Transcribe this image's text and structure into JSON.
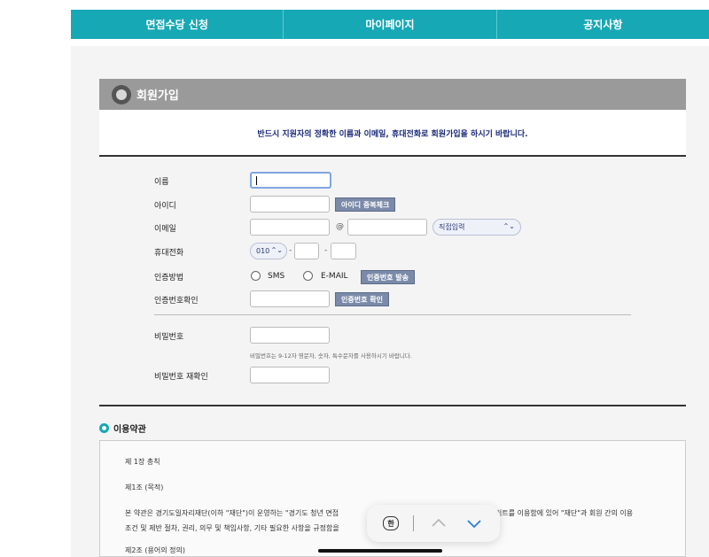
{
  "nav": {
    "items": [
      "면접수당 신청",
      "마이페이지",
      "공지사항"
    ]
  },
  "banner": {
    "title": "회원가입"
  },
  "notice": "반드시 지원자의 정확한 이름과 이메일, 휴대전화로 회원가입을 하시기 바랍니다.",
  "form": {
    "name_label": "이름",
    "id_label": "아이디",
    "id_check_button": "아이디 중복체크",
    "email_label": "이메일",
    "email_at": "@",
    "email_domain_select": "직접입력",
    "phone_label": "휴대전화",
    "phone_prefix": "010",
    "phone_dash": "-",
    "auth_method_label": "인증방법",
    "auth_sms": "SMS",
    "auth_email": "E-MAIL",
    "auth_send_button": "인증번호 발송",
    "auth_confirm_label": "인증번호확인",
    "auth_confirm_button": "인증번호 확인",
    "password_label": "비밀번호",
    "password_hint": "비밀번호는 9-12자 영문자, 숫자, 특수문자를 사용하시기 바랍니다.",
    "password_confirm_label": "비밀번호 재확인"
  },
  "terms": {
    "title": "이용약관",
    "chapter": "제 1장 총칙",
    "article": "제1조 (목적)",
    "body_line1_a": "본 약관은 경기도일자리재단(이하 \"재단\")이 운영하는 \"경기도 청년 면접",
    "body_line1_b": "이트를 이용함에 있어 \"재단\"과 회원 간의 이용",
    "body_line2": "조건 및 제반 절차, 권리, 의무 및 책임사항, 기타 필요한 사항을 규정함을",
    "body_line3": "제2조 (용어의 정의)"
  },
  "toolbar": {
    "han_label": "한"
  }
}
